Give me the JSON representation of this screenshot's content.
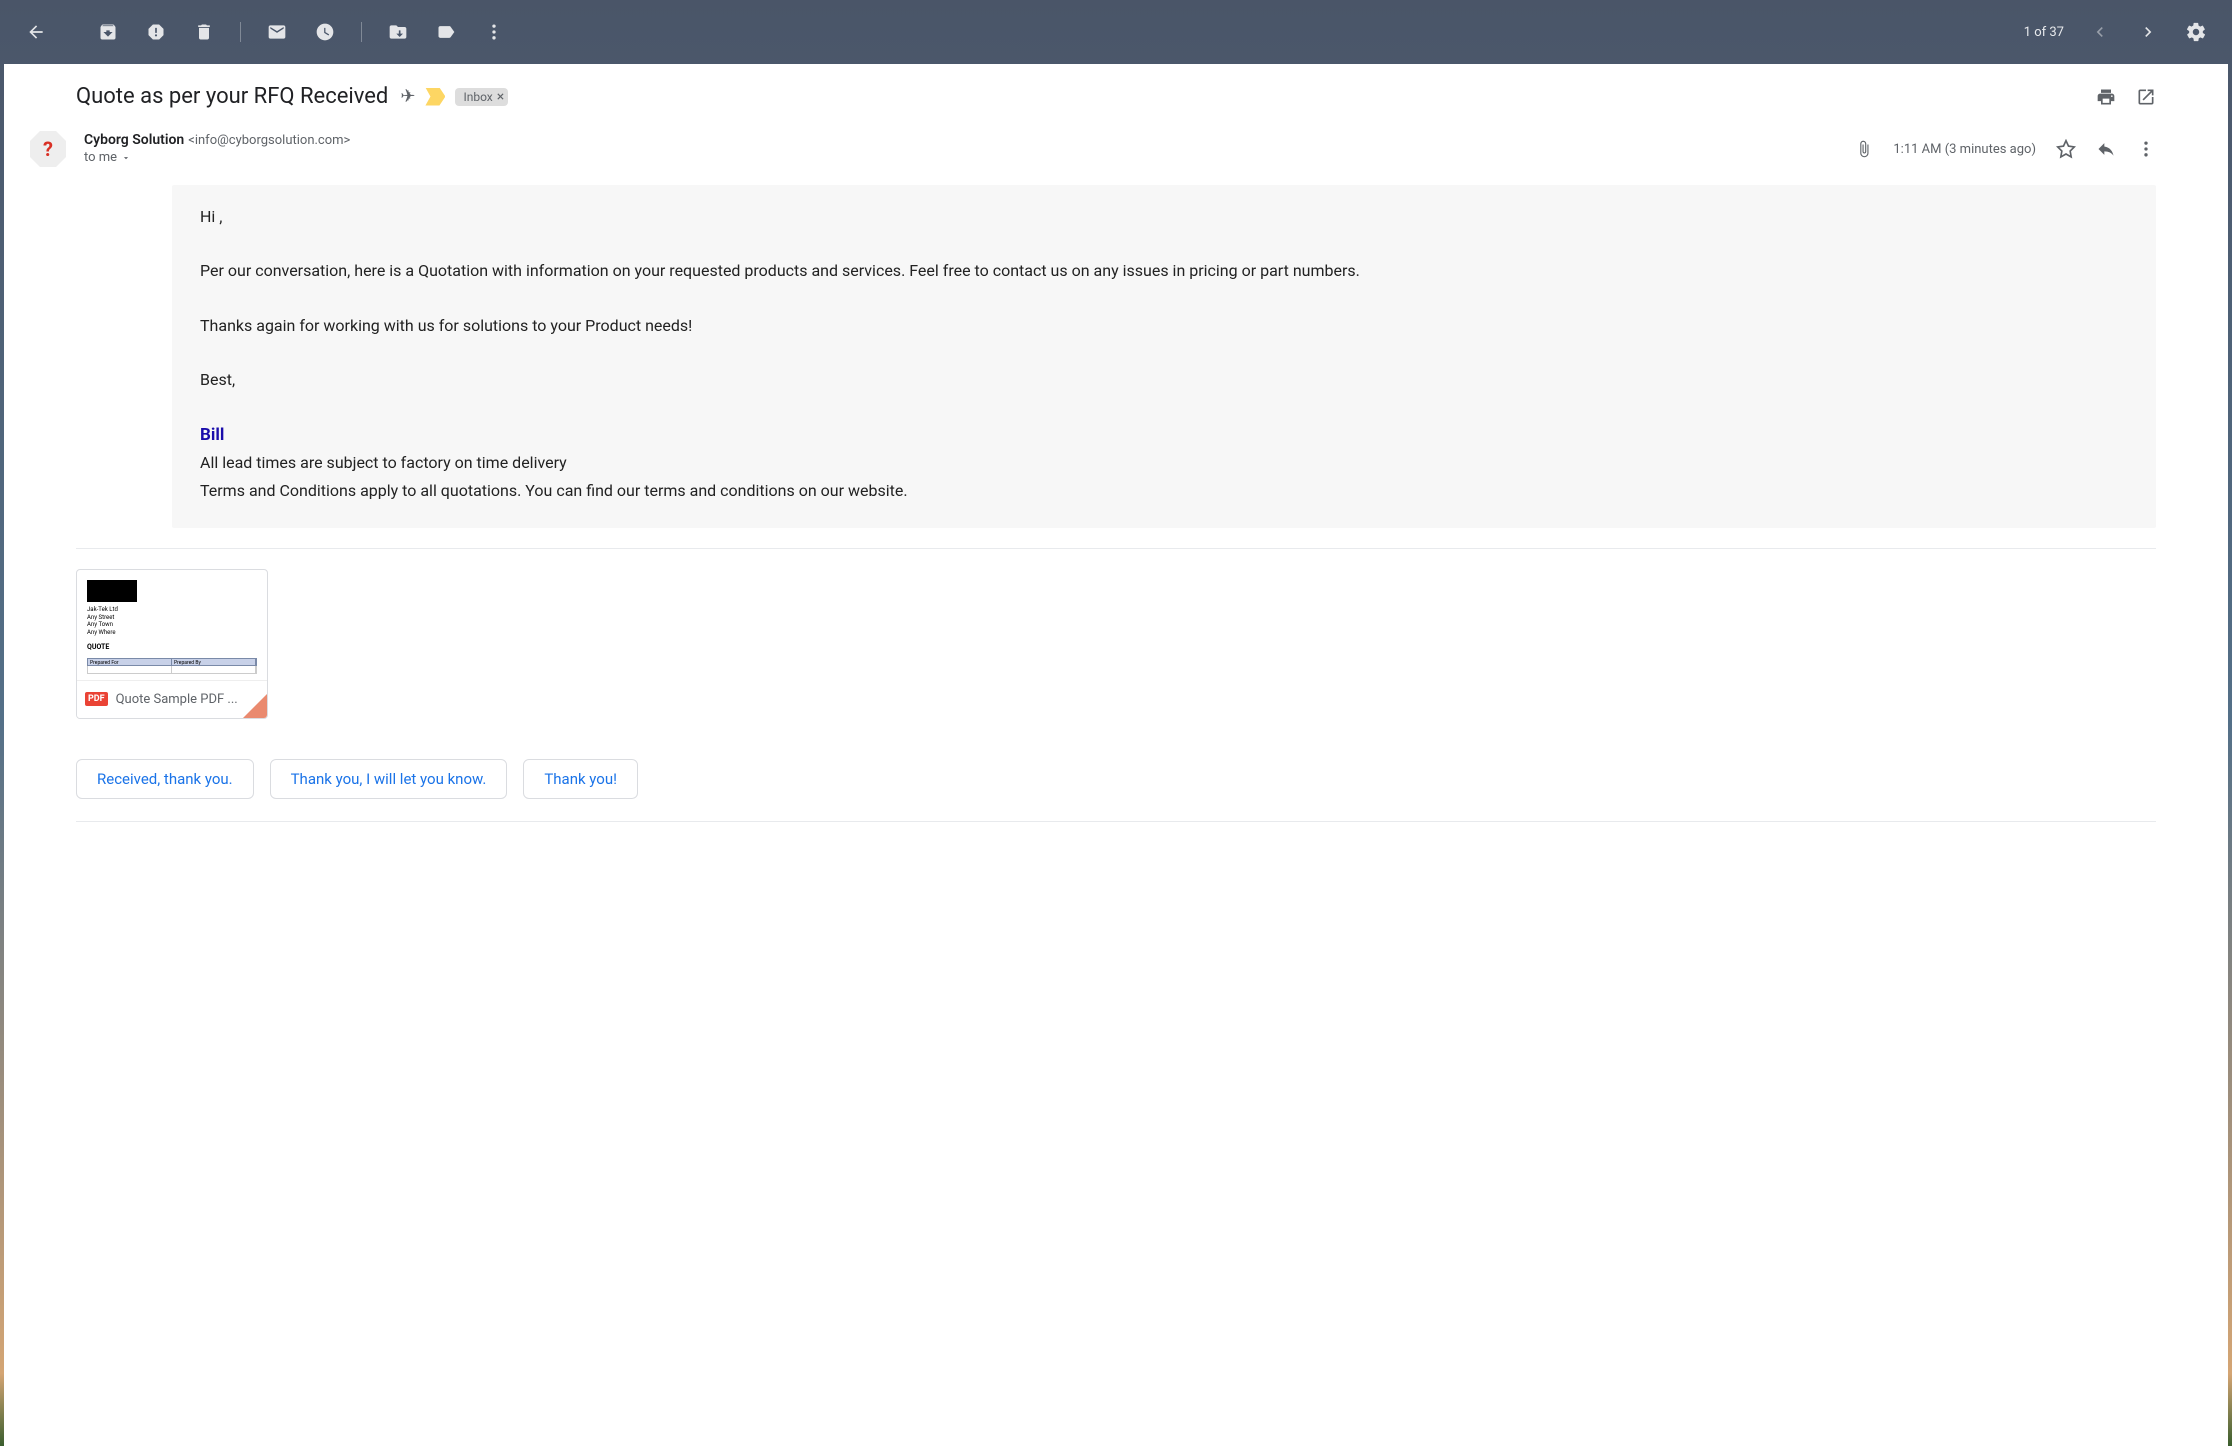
{
  "toolbar": {
    "count_text": "1 of 37"
  },
  "subject": {
    "text": "Quote as per your RFQ Received",
    "label": "Inbox"
  },
  "sender": {
    "avatar_char": "?",
    "name": "Cyborg Solution",
    "email": "<info@cyborgsolution.com>",
    "to": "to me",
    "time": "1:11 AM (3 minutes ago)"
  },
  "body": {
    "greeting": "Hi ,",
    "p1": "Per our conversation, here is a Quotation with information on your requested products and services. Feel free to contact us on any issues in pricing or part numbers.",
    "p2": "Thanks again for working with us for solutions to your Product needs!",
    "closing": "Best,",
    "sig_name": "Bill",
    "sig_line1": "All lead times are subject to factory on time delivery",
    "sig_line2": " Terms and Conditions apply to all quotations.  You can find our terms and conditions on our website."
  },
  "attachment": {
    "badge": "PDF",
    "filename": "Quote Sample PDF ...",
    "preview": {
      "l1": "Jak-Tek Ltd",
      "l2": "Any Street",
      "l3": "Any Town",
      "l4": "Any Where",
      "l5": "QUOTE",
      "h1": "Prepared For",
      "h2": "Prepared By"
    }
  },
  "smart_replies": {
    "r1": "Received, thank you.",
    "r2": "Thank you, I will let you know.",
    "r3": "Thank you!"
  }
}
